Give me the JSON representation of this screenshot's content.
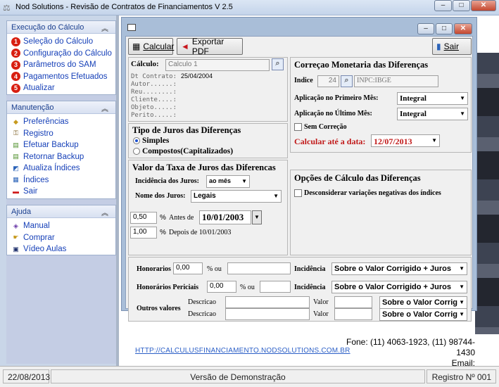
{
  "window": {
    "title": "Nod Solutions -  Revisão de Contratos de Financiamentos V 2.5",
    "minimize": "–",
    "maximize": "□",
    "close": "✕"
  },
  "sidebar": {
    "execucao": {
      "title": "Execução do Cálculo",
      "items": [
        {
          "num": "1",
          "label": "Seleção do Cálculo"
        },
        {
          "num": "2",
          "label": "Configuração do Cálculo"
        },
        {
          "num": "3",
          "label": "Parâmetros do SAM"
        },
        {
          "num": "4",
          "label": "Pagamentos Efetuados"
        },
        {
          "num": "5",
          "label": "Atualizar"
        }
      ]
    },
    "manutencao": {
      "title": "Manutenção",
      "items": [
        {
          "icon": "preferences-icon",
          "label": "Preferências"
        },
        {
          "icon": "register-icon",
          "label": "Registro"
        },
        {
          "icon": "backup-icon",
          "label": "Efetuar Backup"
        },
        {
          "icon": "restore-icon",
          "label": "Retornar Backup"
        },
        {
          "icon": "update-indices-icon",
          "label": "Atualiza Índices"
        },
        {
          "icon": "indices-icon",
          "label": "Índices"
        },
        {
          "icon": "exit-icon",
          "label": "Sair"
        }
      ]
    },
    "ajuda": {
      "title": "Ajuda",
      "items": [
        {
          "icon": "manual-icon",
          "label": "Manual"
        },
        {
          "icon": "buy-icon",
          "label": "Comprar"
        },
        {
          "icon": "video-icon",
          "label": "Vídeo Aulas"
        }
      ]
    }
  },
  "toolbar": {
    "calcular": "Calcular",
    "exportar": "Exportar PDF",
    "sair": "Sair"
  },
  "calculo": {
    "label": "Cálculo:",
    "value": "Calculo 1",
    "dt_contrato_label": "Dt Contrato:",
    "dt_contrato": "25/04/2004",
    "autor": "Autor......:",
    "reu": "Reu........:",
    "cliente": "Cliente....:",
    "objeto": "Objeto.....:",
    "perito": "Perito.....:"
  },
  "tipo_juros": {
    "title": "Tipo de Juros das Diferenças",
    "simples": "Simples",
    "compostos": "Compostos(Capitalizados)",
    "selected": "simples"
  },
  "taxa_juros": {
    "title": "Valor da Taxa de Juros das Diferencas",
    "incidencia_label": "Incidência dos Juros:",
    "incidencia_value": "ao mês",
    "nome_label": "Nome dos Juros:",
    "nome_value": "Legais",
    "taxa1": "0,50",
    "pct": "%",
    "antes_de": "Antes de",
    "data": "10/01/2003",
    "taxa2": "1,00",
    "depois_de": "Depois de 10/01/2003"
  },
  "correcao": {
    "title": "Correçao Monetaria das Diferenças",
    "indice_label": "Indice",
    "indice_num": "24",
    "indice_name": "INPC:IBGE",
    "primeiro_label": "Aplicação no Primeiro Mês:",
    "primeiro_value": "Integral",
    "ultimo_label": "Aplicação no Último Mês:",
    "ultimo_value": "Integral",
    "sem_correcao": "Sem Correção",
    "calcular_ate": "Calcular  até a data:",
    "calcular_data": "12/07/2013"
  },
  "opcoes": {
    "title": "Opções de Cálculo das Diferenças",
    "desconsiderar": "Desconsiderar variações negativas dos índices"
  },
  "honorarios": {
    "label": "Honorarios",
    "value": "0,00",
    "pct_ou": "% ou",
    "incidencia_label": "Incidência",
    "incidencia_value": "Sobre o Valor Corrigido + Juros",
    "periciais_label": "Honorários Periciais",
    "periciais_value": "0,00",
    "periciais_incidencia": "Sobre o Valor Corrigido + Juros",
    "outros_label": "Outros valores",
    "descricao": "Descricao",
    "valor": "Valor",
    "outros_incidencia": "Sobre o Valor Corrig"
  },
  "footer": {
    "link": "HTTP://CALCULUSFINANCIAMENTO.NODSOLUTIONS.COM.BR",
    "fone": "Fone: (11) 4063-1923, (11) 98744-1430",
    "email": "Email: suporte@nodsolutions.com.br"
  },
  "status": {
    "date": "22/08/2013",
    "version": "Versão de Demonstração",
    "registro": "Registro Nº 001"
  }
}
